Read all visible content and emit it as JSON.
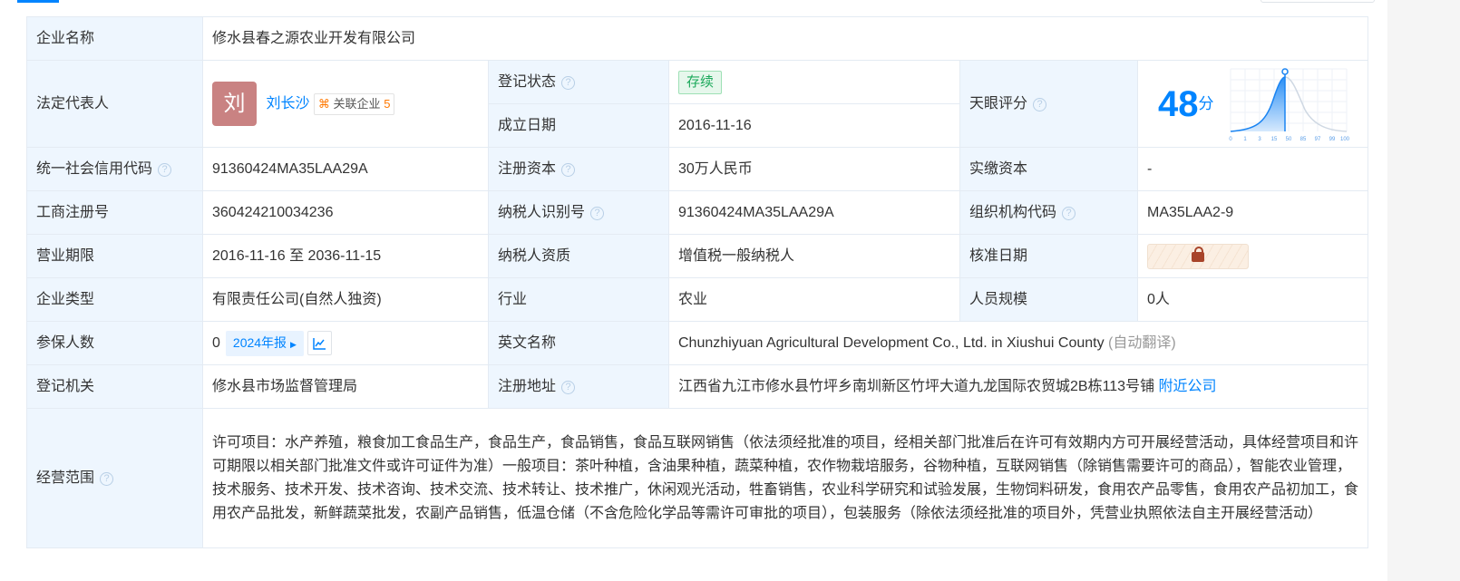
{
  "company_name": {
    "label": "企业名称",
    "value": "修水县春之源农业开发有限公司"
  },
  "legal_rep": {
    "label": "法定代表人",
    "avatar": "刘",
    "name": "刘长沙",
    "related_label": "关联企业",
    "related_count": "5"
  },
  "reg_status": {
    "label": "登记状态",
    "value": "存续"
  },
  "founded": {
    "label": "成立日期",
    "value": "2016-11-16"
  },
  "score": {
    "label": "天眼评分",
    "value": "48",
    "unit": "分",
    "ticks": [
      "0",
      "1",
      "3",
      "15",
      "50",
      "85",
      "97",
      "99",
      "100"
    ]
  },
  "credit_code": {
    "label": "统一社会信用代码",
    "value": "91360424MA35LAA29A"
  },
  "reg_capital": {
    "label": "注册资本",
    "value": "30万人民币"
  },
  "paid_capital": {
    "label": "实缴资本",
    "value": "-"
  },
  "biz_reg_no": {
    "label": "工商注册号",
    "value": "360424210034236"
  },
  "taxpayer_id": {
    "label": "纳税人识别号",
    "value": "91360424MA35LAA29A"
  },
  "org_code": {
    "label": "组织机构代码",
    "value": "MA35LAA2-9"
  },
  "biz_term": {
    "label": "营业期限",
    "value": "2016-11-16 至 2036-11-15"
  },
  "taxpayer_qual": {
    "label": "纳税人资质",
    "value": "增值税一般纳税人"
  },
  "approval_date": {
    "label": "核准日期"
  },
  "company_type": {
    "label": "企业类型",
    "value": "有限责任公司(自然人独资)"
  },
  "industry": {
    "label": "行业",
    "value": "农业"
  },
  "staff_size": {
    "label": "人员规模",
    "value": "0人"
  },
  "insured": {
    "label": "参保人数",
    "value": "0",
    "report": "2024年报"
  },
  "english_name": {
    "label": "英文名称",
    "value": "Chunzhiyuan Agricultural Development Co., Ltd. in Xiushui County",
    "note": "(自动翻译)"
  },
  "reg_authority": {
    "label": "登记机关",
    "value": "修水县市场监督管理局"
  },
  "reg_address": {
    "label": "注册地址",
    "value": "江西省九江市修水县竹坪乡南圳新区竹坪大道九龙国际农贸城2B栋113号铺",
    "link": "附近公司"
  },
  "scope": {
    "label": "经营范围",
    "value": "许可项目：水产养殖，粮食加工食品生产，食品生产，食品销售，食品互联网销售（依法须经批准的项目，经相关部门批准后在许可有效期内方可开展经营活动，具体经营项目和许可期限以相关部门批准文件或许可证件为准）一般项目：茶叶种植，含油果种植，蔬菜种植，农作物栽培服务，谷物种植，互联网销售（除销售需要许可的商品），智能农业管理，技术服务、技术开发、技术咨询、技术交流、技术转让、技术推广，休闲观光活动，牲畜销售，农业科学研究和试验发展，生物饲料研发，食用农产品零售，食用农产品初加工，食用农产品批发，新鲜蔬菜批发，农副产品销售，低温仓储（不含危险化学品等需许可审批的项目），包装服务（除依法须经批准的项目外，凭营业执照依法自主开展经营活动）"
  }
}
